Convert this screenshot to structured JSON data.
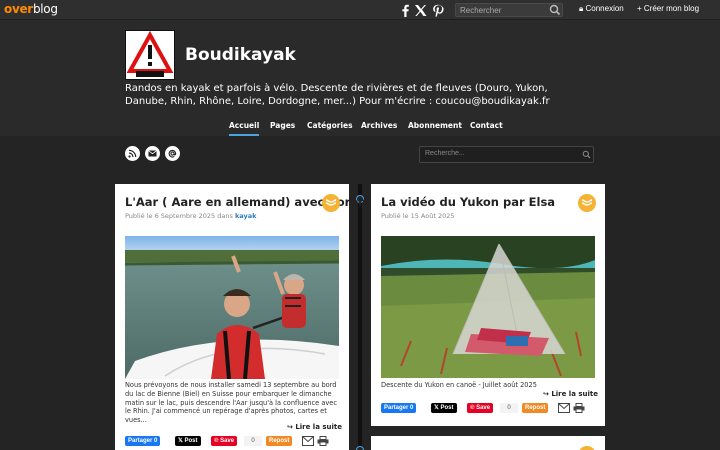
{
  "topbar": {
    "logo_part1": "over",
    "logo_part2": "blog",
    "search_placeholder": "Rechercher",
    "login_label": "Connexion",
    "create_blog_label": "Créer mon blog",
    "social": [
      "facebook-icon",
      "x-icon",
      "pinterest-icon"
    ]
  },
  "header": {
    "title": "Boudikayak",
    "description": "Randos en kayak et parfois à vélo. Descente de rivières et de fleuves (Douro, Yukon, Danube, Rhin, Rhône, Loire, Dordogne, mer...) Pour m'écrire : coucou@boudikayak.fr",
    "nav": [
      {
        "label": "Accueil",
        "active": true
      },
      {
        "label": "Pages"
      },
      {
        "label": "Catégories"
      },
      {
        "label": "Archives"
      },
      {
        "label": "Abonnement"
      },
      {
        "label": "Contact"
      }
    ]
  },
  "content": {
    "search_placeholder": "Recherche...",
    "feed_icons": [
      "rss-icon",
      "mail-icon",
      "at-icon"
    ]
  },
  "posts": [
    {
      "title": "L'Aar ( Aare en allemand) avec Corentin",
      "meta_prefix": "Publié le 6 Septembre 2025 dans ",
      "category": "kayak",
      "excerpt": "Nous prévoyons de nous installer samedi 13 septembre au bord du lac de Bienne (Biel) en Suisse pour embarquer le dimanche matin sur le lac, puis descendre l'Aar jusqu'à la confluence avec le Rhin. J'ai commencé un repérage d'après photos, cartes et vues...",
      "read_more": "Lire la suite",
      "share": {
        "fb": "Partager 0",
        "x": "Post",
        "save": "Save",
        "save_count": "0",
        "repost": "Repost"
      }
    },
    {
      "title": "La vidéo du Yukon par Elsa",
      "meta": "Publié le 15 Août 2025",
      "caption": "Descente du Yukon en canoë - Juillet août 2025",
      "read_more": "Lire la suite",
      "share": {
        "fb": "Partager 0",
        "x": "Post",
        "save": "Save",
        "save_count": "0",
        "repost": "Repost"
      }
    }
  ],
  "colors": {
    "accent": "#4aa3df",
    "badge": "#f5b335",
    "logo_orange": "#ff8c00",
    "category_link": "#2a7bbf"
  }
}
